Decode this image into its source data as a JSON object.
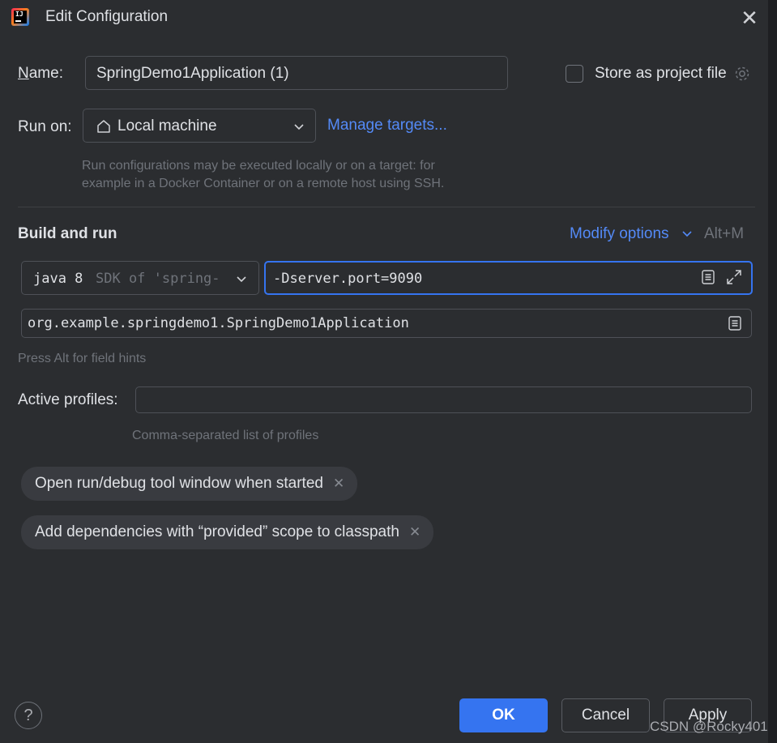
{
  "window": {
    "title": "Edit Configuration",
    "close_label": "✕"
  },
  "name": {
    "label": "Name:",
    "value": "SpringDemo1Application (1)"
  },
  "store": {
    "label": "Store as project file"
  },
  "run_on": {
    "label": "Run on:",
    "value": "Local machine",
    "manage_link": "Manage targets...",
    "hint_line1": "Run configurations may be executed locally or on a target: for",
    "hint_line2": "example in a Docker Container or on a remote host using SSH."
  },
  "build": {
    "heading": "Build and run",
    "modify_options": "Modify options",
    "modify_shortcut": "Alt+M",
    "jdk_value": "java 8",
    "jdk_suffix": "SDK of 'spring-",
    "vm_options": "-Dserver.port=9090",
    "main_class": "org.example.springdemo1.SpringDemo1Application",
    "field_hints": "Press Alt for field hints"
  },
  "profiles": {
    "label": "Active profiles:",
    "value": "",
    "hint": "Comma-separated list of profiles"
  },
  "chips": [
    {
      "label": "Open run/debug tool window when started"
    },
    {
      "label": "Add dependencies with “provided” scope to classpath"
    }
  ],
  "buttons": {
    "help": "?",
    "ok": "OK",
    "cancel": "Cancel",
    "apply": "Apply"
  },
  "watermark": "CSDN @Rocky401",
  "colors": {
    "background": "#2b2d30",
    "accent": "#3574f0",
    "link": "#548af7",
    "focus_border": "#3574f0"
  }
}
